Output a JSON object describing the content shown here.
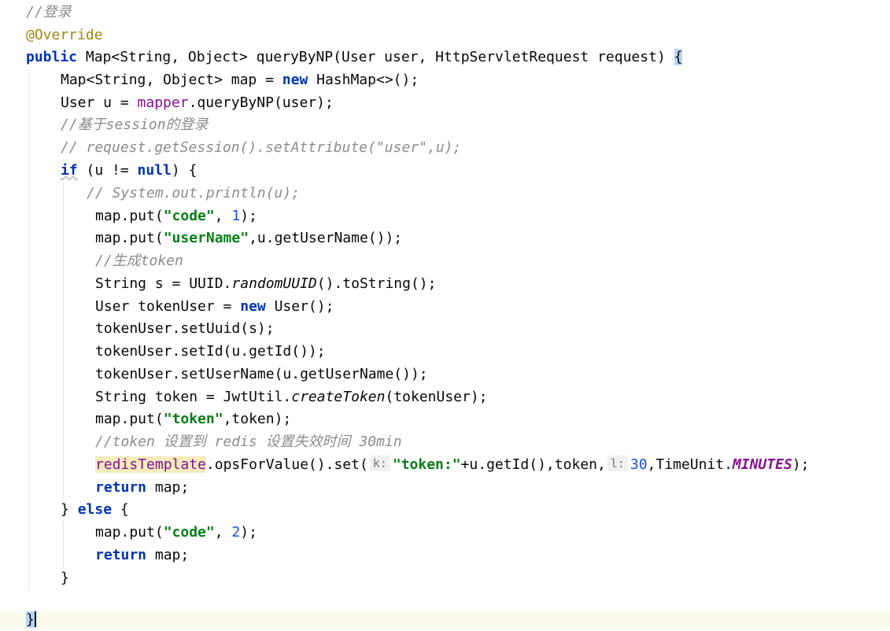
{
  "lines": [
    {
      "text": "//登录"
    },
    {
      "text": "@Override"
    },
    {
      "kw_public": "public",
      "sig_a": " Map<String, Object> queryByNP(User user, HttpServletRequest request) ",
      "brace": "{"
    },
    {
      "a": "Map<String, Object> map = ",
      "kw": "new",
      "b": " HashMap<>();"
    },
    {
      "a": "User u = ",
      "field": "mapper",
      "b": ".queryByNP(user);"
    },
    {
      "text": "//基于session的登录"
    },
    {
      "text": "// request.getSession().setAttribute(\"user\",u);"
    },
    {
      "kw": "if",
      "a": " (u != ",
      "kw2": "null",
      "b": ") {"
    },
    {
      "text": "// System.out.println(u);"
    },
    {
      "a": "map.put(",
      "str": "\"code\"",
      "b": ", ",
      "num": "1",
      "c": ");"
    },
    {
      "a": "map.put(",
      "str": "\"userName\"",
      "b": ",u.getUserName());"
    },
    {
      "text": "//生成token"
    },
    {
      "a": "String s = UUID.",
      "italic": "randomUUID",
      "b": "().toString();"
    },
    {
      "a": "User tokenUser = ",
      "kw": "new",
      "b": " User();"
    },
    {
      "text": "tokenUser.setUuid(s);"
    },
    {
      "text": "tokenUser.setId(u.getId());"
    },
    {
      "text": "tokenUser.setUserName(u.getUserName());"
    },
    {
      "a": "String token = JwtUtil.",
      "italic": "createToken",
      "b": "(tokenUser);"
    },
    {
      "a": "map.put(",
      "str": "\"token\"",
      "b": ",token);"
    },
    {
      "text": "//token 设置到 redis 设置失效时间 30min"
    },
    {
      "field": "redisTemplate",
      "a": ".opsForValue().set(",
      "hint1": "k:",
      "str": "\"token:\"",
      "b": "+u.getId(),token,",
      "hint2": "l:",
      "num": "30",
      "c": ",TimeUnit.",
      "const": "MINUTES",
      "d": ");"
    },
    {
      "kw": "return",
      "a": " map;"
    },
    {
      "a": "} ",
      "kw": "else",
      "b": " {"
    },
    {
      "a": "map.put(",
      "str": "\"code\"",
      "b": ", ",
      "num": "2",
      "c": ");"
    },
    {
      "kw": "return",
      "a": " map;"
    },
    {
      "text": "}"
    },
    {
      "text": "}"
    }
  ],
  "colors": {
    "keyword": "#0033b3",
    "string": "#067d17",
    "number": "#1750eb",
    "comment": "#8c8c8c",
    "annotation": "#9e880d",
    "field": "#871094",
    "caret_line_bg": "#fcfaed",
    "brace_match_bg": "#b5d7f5"
  }
}
